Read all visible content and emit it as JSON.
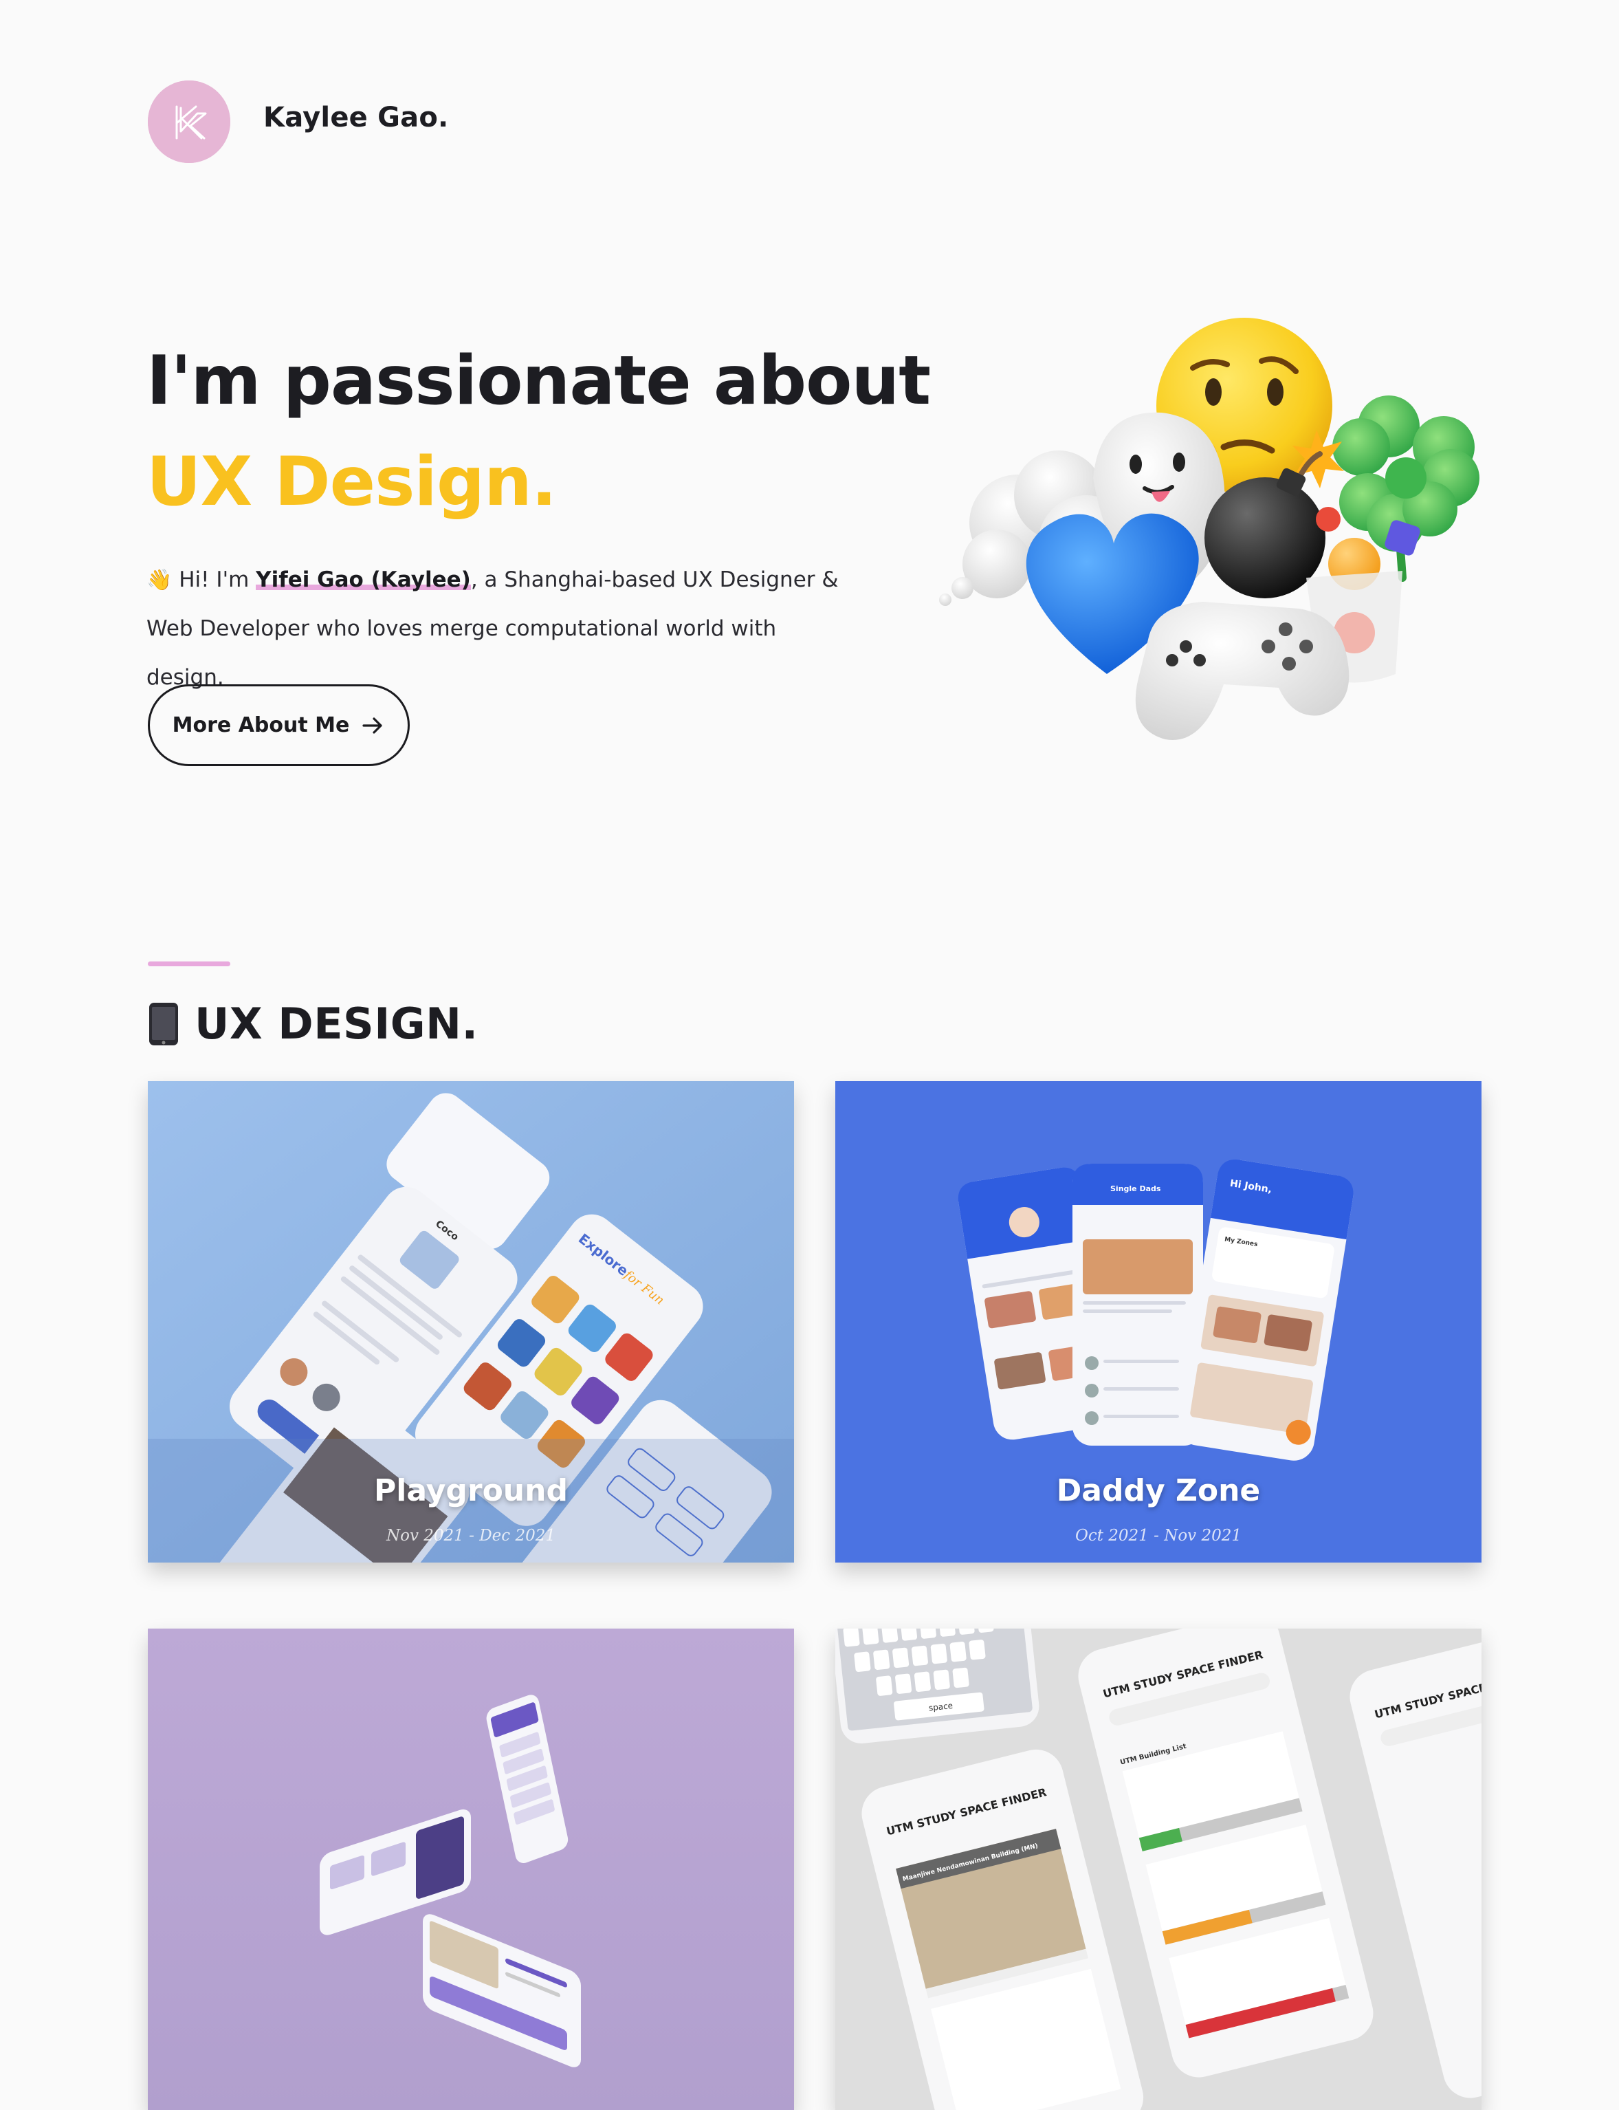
{
  "header": {
    "brand_name": "Kaylee Gao."
  },
  "hero": {
    "title": "I'm passionate about",
    "accent": "UX Design.",
    "intro_prefix": "Hi! I'm ",
    "intro_name": "Yifei Gao (Kaylee)",
    "intro_suffix": ", a Shanghai-based UX Designer & Web Developer who loves merge computational world with design.",
    "button_label": "More About Me"
  },
  "section": {
    "title": "UX DESIGN."
  },
  "projects": [
    {
      "title": "Playground",
      "date": "Nov 2021 - Dec 2021"
    },
    {
      "title": "Daddy Zone",
      "date": "Oct 2021 - Nov 2021"
    },
    {
      "title": "",
      "date": ""
    },
    {
      "title": "",
      "date": ""
    }
  ],
  "mockup_text": {
    "playground": {
      "screen_a": "Coco",
      "screen_b": "Explore",
      "screen_b2": "for Fun"
    },
    "daddy_zone": {
      "screen_b": "Single Dads",
      "screen_c": "Hi John,",
      "screen_c_zones": "My Zones"
    },
    "utm": {
      "app_title": "UTM STUDY SPACE FINDER",
      "building": "Maanjiwe Nendamowinan Building (MN)",
      "list_title": "UTM Building List",
      "space_key": "space"
    }
  },
  "colors": {
    "accent_yellow": "#f9c11f",
    "highlight_pink": "#e8a8dd",
    "logo_pink": "#e6b6d5",
    "card_blue_light": "#8fb5e6",
    "card_blue": "#4a74e0",
    "card_purple": "#b9a8d3",
    "card_gray": "#dcdcdc"
  }
}
